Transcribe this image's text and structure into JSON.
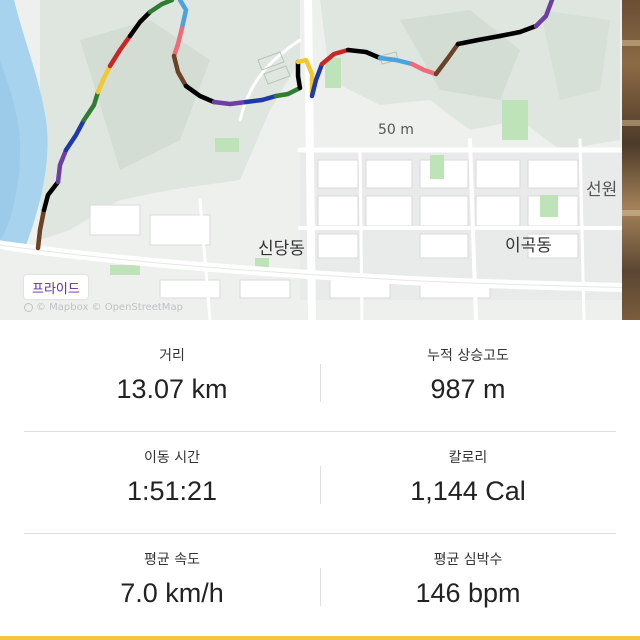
{
  "map": {
    "sport_badge": "프라이드",
    "places": {
      "sindang": "신당동",
      "igok": "이곡동",
      "seon": "선원"
    },
    "contour_label": "50 m",
    "attribution": "© Mapbox © OpenStreetMap"
  },
  "stats": [
    {
      "label": "거리",
      "value": "13.07 km"
    },
    {
      "label": "누적 상승고도",
      "value": "987 m"
    },
    {
      "label": "이동 시간",
      "value": "1:51:21"
    },
    {
      "label": "칼로리",
      "value": "1,144 Cal"
    },
    {
      "label": "평균 속도",
      "value": "7.0 km/h"
    },
    {
      "label": "평균 심박수",
      "value": "146 bpm"
    }
  ],
  "colors": {
    "route_segments": [
      "#c62828",
      "#1e3aa8",
      "#2e7d32",
      "#f2c72f",
      "#000000",
      "#6d3fa0",
      "#6b4226",
      "#f06a7a",
      "#4aa3df"
    ],
    "river": "#a8d3ee",
    "badge_text": "#5c2ea0",
    "bottom_strip": "#f4c542"
  }
}
